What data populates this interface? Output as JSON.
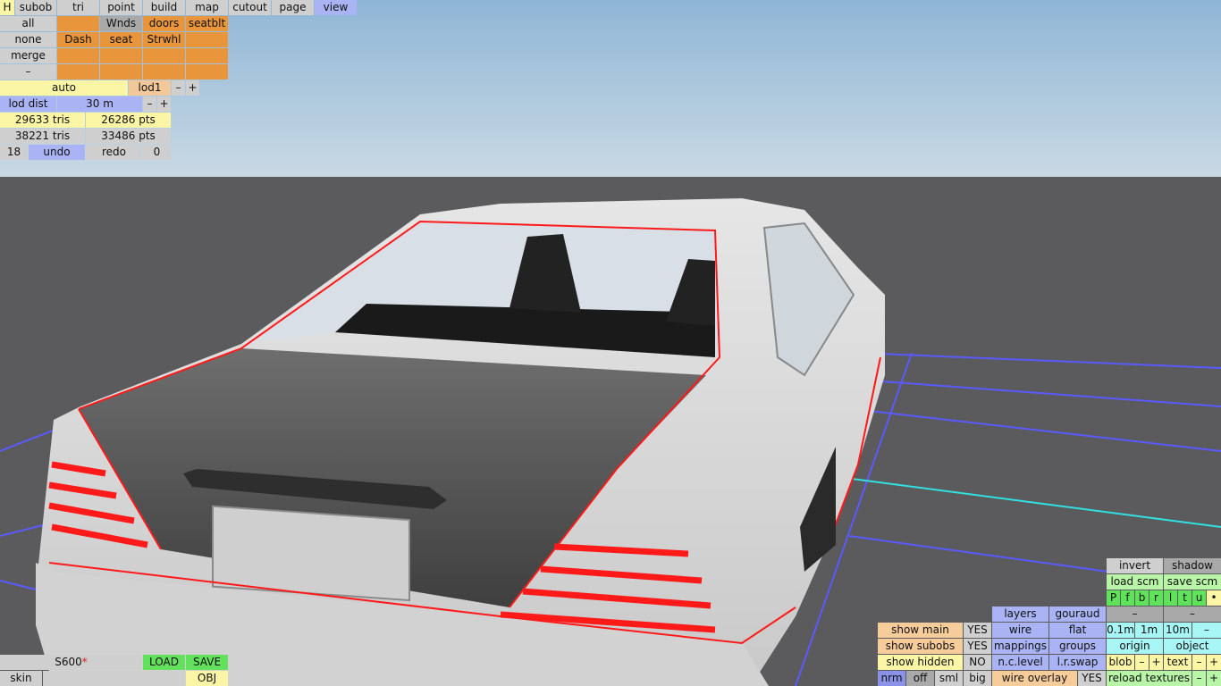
{
  "top_menu": {
    "h": "H",
    "subob": "subob",
    "tri": "tri",
    "point": "point",
    "build": "build",
    "map": "map",
    "cutout": "cutout",
    "page": "page",
    "view": "view"
  },
  "selection": {
    "all": "all",
    "none": "none",
    "merge": "merge",
    "minus": "–",
    "wnds": "Wnds",
    "doors": "doors",
    "seatblt": "seatblt",
    "dash": "Dash",
    "seat": "seat",
    "strwhl": "Strwhl"
  },
  "lod": {
    "auto": "auto",
    "lod1": "lod1",
    "minus": "–",
    "plus": "+",
    "lod_dist_label": "lod dist",
    "lod_dist_value": "30 m"
  },
  "stats": {
    "tris1": "29633 tris",
    "pts1": "26286 pts",
    "tris2": "38221 tris",
    "pts2": "33486 pts"
  },
  "history": {
    "count": "18",
    "undo": "undo",
    "redo": "redo",
    "redo_count": "0"
  },
  "file": {
    "name": "S600",
    "modified_mark": "*",
    "load": "LOAD",
    "save": "SAVE",
    "skin": "skin",
    "obj": "OBJ"
  },
  "right_panel": {
    "invert": "invert",
    "shadow": "shadow",
    "load_scm": "load scm",
    "save_scm": "save scm",
    "flags": [
      "P",
      "f",
      "b",
      "r",
      "l",
      "t",
      "u",
      "•"
    ],
    "layers": "layers",
    "gouraud": "gouraud",
    "dash1": "–",
    "dash2": "–",
    "show_main": "show main",
    "show_main_val": "YES",
    "wire": "wire",
    "flat": "flat",
    "m01": "0.1m",
    "m1": "1m",
    "m10": "10m",
    "mminus": "–",
    "show_subobs": "show subobs",
    "show_subobs_val": "YES",
    "mappings": "mappings",
    "groups": "groups",
    "origin": "origin",
    "object": "object",
    "show_hidden": "show hidden",
    "show_hidden_val": "NO",
    "nc_level": "n.c.level",
    "lr_swap": "l.r.swap",
    "blob": "blob",
    "blob_minus": "–",
    "blob_plus": "+",
    "text": "text",
    "text_minus": "–",
    "text_plus": "+",
    "nrm": "nrm",
    "off": "off",
    "sml": "sml",
    "big": "big",
    "wire_overlay": "wire overlay",
    "wire_overlay_val": "YES",
    "reload_textures": "reload textures",
    "reload_minus": "–",
    "reload_plus": "+"
  },
  "colors": {
    "orange": "#e8953c",
    "blue": "#aab4f5",
    "yellow": "#fbf6a6",
    "green": "#63e05c",
    "cyan": "#a7f5f5",
    "red_outline": "#ff1a1a"
  }
}
